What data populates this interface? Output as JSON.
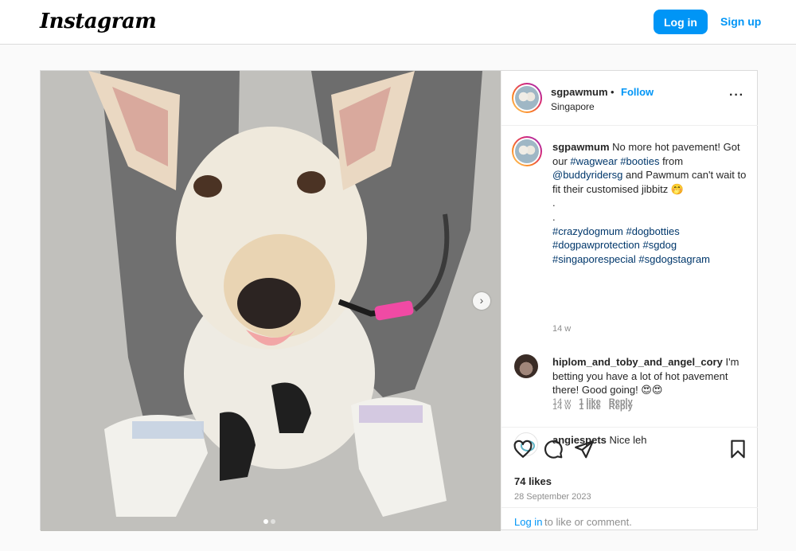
{
  "topbar": {
    "logo": "Instagram",
    "login_label": "Log in",
    "signup_label": "Sign up"
  },
  "post": {
    "username": "sgpawmum",
    "separator": "•",
    "follow_label": "Follow",
    "location": "Singapore",
    "caption": {
      "username": "sgpawmum",
      "text_1": "No more hot pavement! Got our ",
      "tag_wagwear": "#wagwear",
      "tag_booties": "#booties",
      "text_2": " from ",
      "mention": "@buddyridersg",
      "text_3": " and Pawmum can't wait to fit their customised jibbitz 🤭",
      "dot_line": ".",
      "tags_1": "#crazydogmum #dogbotties",
      "tags_2": "#dogpawprotection #sgdog",
      "tags_3": "#singaporespecial #sgdogstagram",
      "time": "14 w"
    },
    "comments": [
      {
        "username": "hiplom_and_toby_and_angel_cory",
        "text": "I'm betting you have a lot of hot pavement there! Good going! 😍😍",
        "time": "14 w",
        "likes": "1 like",
        "reply": "Reply"
      },
      {
        "username": "angiespets",
        "text": "Nice leh",
        "time": "14 w",
        "likes": "1 like",
        "reply": "Reply"
      }
    ],
    "likes_count": "74 likes",
    "date": "28 September 2023",
    "login_prompt_link": "Log in",
    "login_prompt_text": "to like or comment.",
    "carousel_arrow": "›",
    "colors": {
      "accent": "#0095f6",
      "hashtag": "#00376b",
      "muted": "#8e8e8e"
    }
  }
}
